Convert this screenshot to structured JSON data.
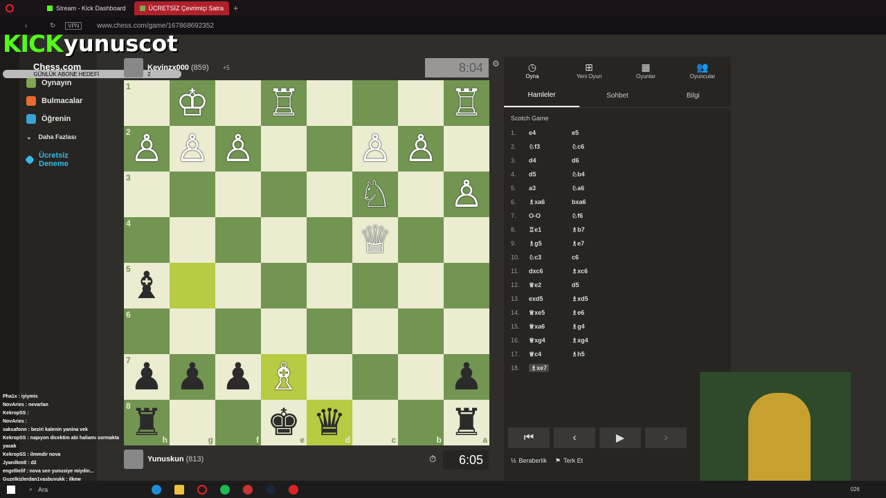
{
  "browser": {
    "tabs": [
      {
        "label": "Stream - Kick Dashboard"
      },
      {
        "label": "ÜCRETSİZ Çevrimiçi Satra"
      }
    ],
    "url": "www.chess.com/game/167868692352",
    "vpn": "VPN"
  },
  "overlay": {
    "kick_logo": "KICK",
    "username": "yunuscot",
    "goal_label": "GÜNLÜK ABONE HEDEFİ",
    "goal_count": "2"
  },
  "sidebar": {
    "logo": "Chess.com",
    "items": [
      {
        "label": "Oynayın",
        "icon": "pawn-icon",
        "color": "#7fa650"
      },
      {
        "label": "Bulmacalar",
        "icon": "puzzle-icon",
        "color": "#e86c2c"
      },
      {
        "label": "Öğrenin",
        "icon": "learn-icon",
        "color": "#3aa0d8"
      },
      {
        "label": "Daha Fazlası",
        "icon": "chevron-down-icon",
        "color": "#aaa"
      },
      {
        "label": "Ücretsiz Deneme",
        "icon": "diamond-icon",
        "color": "#38b8e8"
      }
    ]
  },
  "game": {
    "opponent": {
      "name": "Kevinzx000",
      "rating": "(859)",
      "captured": "+5"
    },
    "me": {
      "name": "Yunuskun",
      "rating": "(813)"
    },
    "clock_top": "8:04",
    "clock_bottom": "6:05",
    "ranks": [
      "1",
      "2",
      "3",
      "4",
      "5",
      "6",
      "7",
      "8"
    ],
    "files": [
      "h",
      "g",
      "f",
      "e",
      "d",
      "c",
      "b",
      "a"
    ],
    "pieces": [
      {
        "sq": "g1",
        "p": "♔",
        "c": "w"
      },
      {
        "sq": "e1",
        "p": "♖",
        "c": "w"
      },
      {
        "sq": "a1",
        "p": "♖",
        "c": "w"
      },
      {
        "sq": "h2",
        "p": "♙",
        "c": "w"
      },
      {
        "sq": "g2",
        "p": "♙",
        "c": "w"
      },
      {
        "sq": "f2",
        "p": "♙",
        "c": "w"
      },
      {
        "sq": "c2",
        "p": "♙",
        "c": "w"
      },
      {
        "sq": "b2",
        "p": "♙",
        "c": "w"
      },
      {
        "sq": "c3",
        "p": "♘",
        "c": "w"
      },
      {
        "sq": "a3",
        "p": "♙",
        "c": "w"
      },
      {
        "sq": "c4",
        "p": "♕",
        "c": "w"
      },
      {
        "sq": "h5",
        "p": "♝",
        "c": "b"
      },
      {
        "sq": "h7",
        "p": "♟",
        "c": "b"
      },
      {
        "sq": "g7",
        "p": "♟",
        "c": "b"
      },
      {
        "sq": "f7",
        "p": "♟",
        "c": "b"
      },
      {
        "sq": "e7",
        "p": "♗",
        "c": "w"
      },
      {
        "sq": "a7",
        "p": "♟",
        "c": "b"
      },
      {
        "sq": "h8",
        "p": "♜",
        "c": "b"
      },
      {
        "sq": "e8",
        "p": "♚",
        "c": "b"
      },
      {
        "sq": "d8",
        "p": "♛",
        "c": "b"
      },
      {
        "sq": "a8",
        "p": "♜",
        "c": "b"
      }
    ],
    "highlights": [
      "g5",
      "e7",
      "d8"
    ]
  },
  "panel": {
    "tabs": [
      {
        "label": "Oyna",
        "icon": "clock-icon"
      },
      {
        "label": "Yeni Oyun",
        "icon": "plus-icon"
      },
      {
        "label": "Oyunlar",
        "icon": "board-icon"
      },
      {
        "label": "Oyuncular",
        "icon": "players-icon"
      }
    ],
    "subtabs": [
      "Hamleler",
      "Sohbet",
      "Bilgi"
    ],
    "opening": "Scotch Game",
    "moves": [
      {
        "n": "1.",
        "w": "e4",
        "b": "e5"
      },
      {
        "n": "2.",
        "w": "♘f3",
        "b": "♘c6"
      },
      {
        "n": "3.",
        "w": "d4",
        "b": "d6"
      },
      {
        "n": "4.",
        "w": "d5",
        "b": "♘b4"
      },
      {
        "n": "5.",
        "w": "a3",
        "b": "♘a6"
      },
      {
        "n": "6.",
        "w": "♗xa6",
        "b": "bxa6"
      },
      {
        "n": "7.",
        "w": "O-O",
        "b": "♘f6"
      },
      {
        "n": "8.",
        "w": "♖e1",
        "b": "♗b7"
      },
      {
        "n": "9.",
        "w": "♗g5",
        "b": "♗e7"
      },
      {
        "n": "10.",
        "w": "♘c3",
        "b": "c6"
      },
      {
        "n": "11.",
        "w": "dxc6",
        "b": "♗xc6"
      },
      {
        "n": "12.",
        "w": "♕e2",
        "b": "d5"
      },
      {
        "n": "13.",
        "w": "exd5",
        "b": "♗xd5"
      },
      {
        "n": "14.",
        "w": "♕xe5",
        "b": "♗e6"
      },
      {
        "n": "15.",
        "w": "♕xa6",
        "b": "♗g4"
      },
      {
        "n": "16.",
        "w": "♕xg4",
        "b": "♗xg4"
      },
      {
        "n": "17.",
        "w": "♕c4",
        "b": "♗h5"
      },
      {
        "n": "18.",
        "w": "♗xe7",
        "b": ""
      }
    ],
    "draw": "Beraberlik",
    "resign": "Terk Et"
  },
  "chat": [
    "Pha1x : iyiymis",
    "NovAries : nevarlan",
    "KekropSS :",
    "NovAries :",
    "saksafonn : beziri kalenin yanina vek",
    "KekropSS : napıyon dicektim abi haliamı sormakta yasak",
    "KekropSS : ilmmdir nova",
    "Jyanilkmtl : d2",
    "engellielif : nova sen yunusiye miydin...",
    "Guzelkizlerdan1yasbuyukk : ilkew"
  ],
  "taskbar": {
    "search": "Ara",
    "year": "026"
  }
}
